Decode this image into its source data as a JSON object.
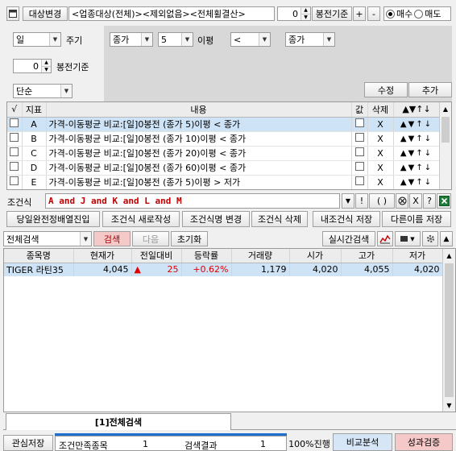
{
  "toolbar": {
    "category_button": "대상변경",
    "filter_text": "<업종대상(전체)><제외없음><전체휠결산>",
    "offset_value": "0",
    "offset_label": "봉전기준",
    "plus": "+",
    "minus": "-",
    "buy_label": "매수",
    "sell_label": "매도"
  },
  "settings": {
    "period": "일",
    "period_label": "주기",
    "offset_value": "0",
    "offset_label": "봉전기준",
    "mode": "단순",
    "field1": "종가",
    "ma_period": "5",
    "ma_label": "이평",
    "operator": "<",
    "field2": "종가",
    "modify_button": "수정",
    "add_button": "추가"
  },
  "conditions": {
    "headers": [
      "√",
      "지표",
      "내용",
      "값",
      "삭제",
      "▲▼↑↓"
    ],
    "rows": [
      {
        "id": "A",
        "text": "가격-이동평균 비교:[일]0봉전 (종가 5)이평 < 종가",
        "selected": true
      },
      {
        "id": "B",
        "text": "가격-이동평균 비교:[일]0봉전 (종가 10)이평 < 종가",
        "selected": false
      },
      {
        "id": "C",
        "text": "가격-이동평균 비교:[일]0봉전 (종가 20)이평 < 종가",
        "selected": false
      },
      {
        "id": "D",
        "text": "가격-이동평균 비교:[일]0봉전 (종가 60)이평 < 종가",
        "selected": false
      },
      {
        "id": "E",
        "text": "가격-이동평균 비교:[일]0봉전 (종가 5)이평 > 저가",
        "selected": false
      }
    ],
    "delete_mark": "X"
  },
  "formula": {
    "label": "조건식",
    "expression": "A and J and K and L and M"
  },
  "actions": {
    "b1": "당일완전정배열진입",
    "b2": "조건식 새로작성",
    "b3": "조건식명 변경",
    "b4": "조건식 삭제",
    "b5": "내조건식 저장",
    "b6": "다른이름 저장"
  },
  "search": {
    "scope": "전체검색",
    "search_button": "검색",
    "next_button": "다음",
    "reset_button": "초기화",
    "realtime_button": "실시간검색"
  },
  "results": {
    "headers": [
      "종목명",
      "현재가",
      "전일대비",
      "등락률",
      "거래량",
      "시가",
      "고가",
      "저가"
    ],
    "rows": [
      {
        "name": "TIGER 라틴35",
        "price": "4,045",
        "arrow": "▲",
        "change": "25",
        "rate": "+0.62%",
        "volume": "1,179",
        "open": "4,020",
        "high": "4,055",
        "low": "4,020"
      }
    ]
  },
  "tab": {
    "label": "[1]전체검색"
  },
  "status": {
    "watch_save": "관심저장",
    "count_label": "조건만족종목",
    "count_value": "1",
    "result_label": "검색결과",
    "result_value": "1",
    "progress_label": "100%진행",
    "progress": 1.0,
    "compare_button": "비교분석",
    "performance_button": "성과검증"
  },
  "colors": {
    "up": "#e00000",
    "selected_row": "#cfe3f6",
    "search_button_bg": "#f6c9c9",
    "compare_bg": "#d6e6f6",
    "performance_bg": "#f6c9c9",
    "progress_bar": "#1f6fd0"
  }
}
